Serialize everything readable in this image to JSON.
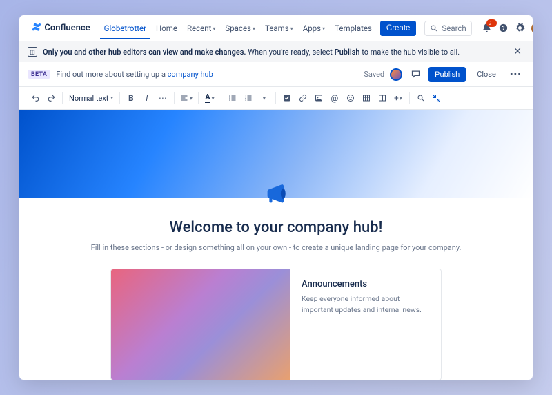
{
  "brand": "Confluence",
  "nav": {
    "items": [
      "Globetrotter",
      "Home",
      "Recent",
      "Spaces",
      "Teams",
      "Apps",
      "Templates"
    ],
    "has_dropdown": [
      false,
      false,
      true,
      true,
      true,
      true,
      false
    ],
    "active_index": 0,
    "create": "Create"
  },
  "search": {
    "placeholder": "Search"
  },
  "notifications": {
    "badge": "9+"
  },
  "banner": {
    "bold": "Only you and other hub editors can view and make changes.",
    "rest_a": " When you're ready, select ",
    "rest_bold": "Publish",
    "rest_b": " to make the hub visible to all."
  },
  "subheader": {
    "badge": "BETA",
    "text_a": "Find out more about setting up a ",
    "link": "company hub",
    "saved": "Saved",
    "publish": "Publish",
    "close": "Close"
  },
  "toolbar": {
    "text_style": "Normal text"
  },
  "page": {
    "heading": "Welcome to your company hub!",
    "sub": "Fill in these sections - or design something all on your own - to create a unique landing page for your company."
  },
  "card": {
    "title": "Announcements",
    "desc": "Keep everyone informed about important updates and internal news."
  }
}
